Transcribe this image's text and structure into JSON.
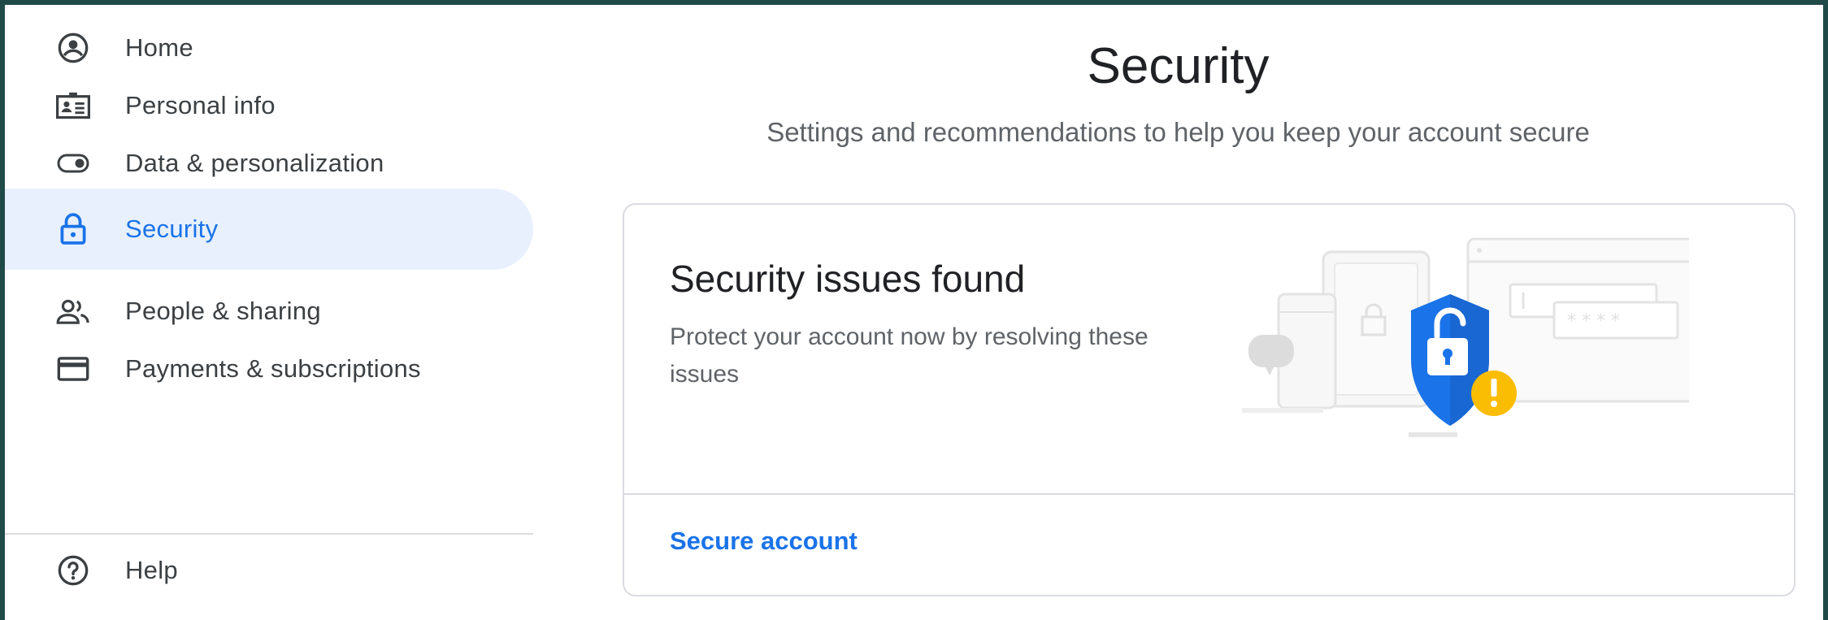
{
  "sidebar": {
    "items": [
      {
        "label": "Home",
        "icon": "account-circle-icon"
      },
      {
        "label": "Personal info",
        "icon": "id-card-icon"
      },
      {
        "label": "Data & personalization",
        "icon": "toggle-icon"
      },
      {
        "label": "Security",
        "icon": "lock-icon",
        "active": true
      },
      {
        "label": "People & sharing",
        "icon": "people-icon"
      },
      {
        "label": "Payments & subscriptions",
        "icon": "credit-card-icon"
      }
    ],
    "footer_items": [
      {
        "label": "Help",
        "icon": "help-icon"
      }
    ]
  },
  "main": {
    "title": "Security",
    "subtitle": "Settings and recommendations to help you keep your account secure",
    "card": {
      "title": "Security issues found",
      "description": "Protect your account now by resolving these issues",
      "action_label": "Secure account"
    }
  },
  "colors": {
    "accent": "#1a73e8",
    "active_bg": "#e8f0fe",
    "warning": "#fbbc04",
    "shield": "#1a73e8",
    "frame_bg": "#1f4a48"
  }
}
